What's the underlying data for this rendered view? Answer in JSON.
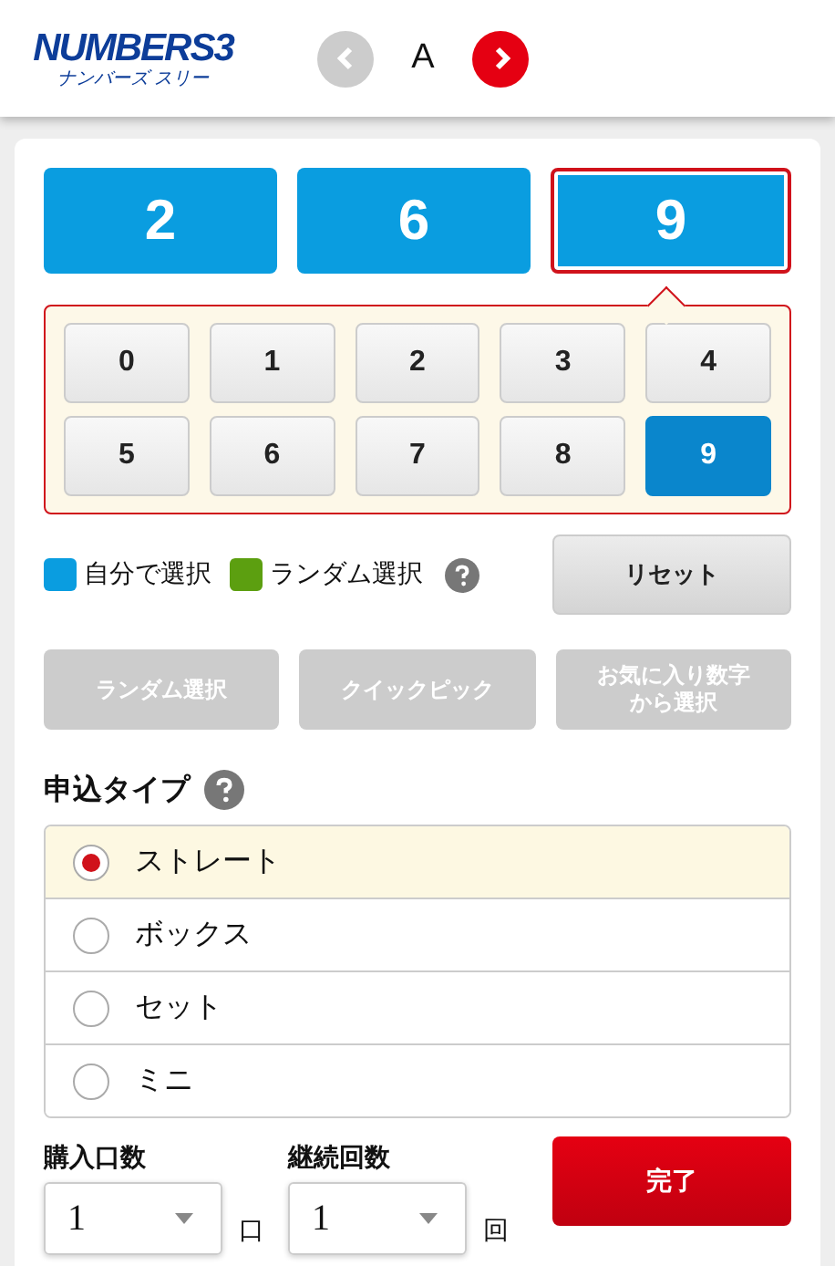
{
  "header": {
    "logo": {
      "title": "NUMBERS3",
      "subtitle": "ナンバーズ スリー"
    },
    "nav": {
      "prev": {
        "disabled": true
      },
      "label": "A",
      "next": {
        "disabled": false
      }
    }
  },
  "digits": [
    {
      "value": "2",
      "selected": false
    },
    {
      "value": "6",
      "selected": false
    },
    {
      "value": "9",
      "selected": true
    }
  ],
  "keypad": [
    {
      "label": "0",
      "selected": false
    },
    {
      "label": "1",
      "selected": false
    },
    {
      "label": "2",
      "selected": false
    },
    {
      "label": "3",
      "selected": false
    },
    {
      "label": "4",
      "selected": false
    },
    {
      "label": "5",
      "selected": false
    },
    {
      "label": "6",
      "selected": false
    },
    {
      "label": "7",
      "selected": false
    },
    {
      "label": "8",
      "selected": false
    },
    {
      "label": "9",
      "selected": true
    }
  ],
  "legend": [
    {
      "label": "自分で選択",
      "color": "#0a9de0"
    },
    {
      "label": "ランダム選択",
      "color": "#5c9f10"
    }
  ],
  "reset": {
    "label": "リセット"
  },
  "actions": [
    {
      "label": "ランダム選択",
      "disabled": true
    },
    {
      "label": "クイックピック",
      "disabled": true
    },
    {
      "label": "お気に入り数字から選択",
      "disabled": true
    }
  ],
  "type_section": {
    "title": "申込タイプ",
    "options": [
      {
        "label": "ストレート",
        "selected": true
      },
      {
        "label": "ボックス",
        "selected": false
      },
      {
        "label": "セット",
        "selected": false
      },
      {
        "label": "ミニ",
        "selected": false
      }
    ]
  },
  "purchase": {
    "quantity": {
      "label": "購入口数",
      "value": "1",
      "unit": "口"
    },
    "repeat": {
      "label": "継続回数",
      "value": "1",
      "unit": "回"
    },
    "submit": {
      "label": "完了"
    }
  }
}
